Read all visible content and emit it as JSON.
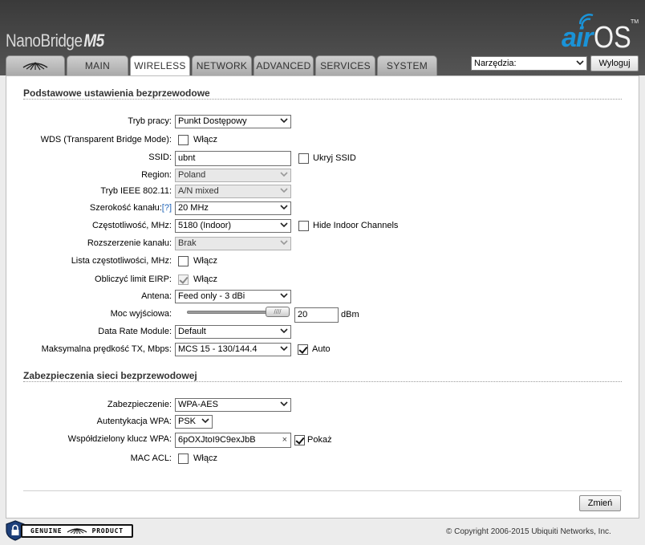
{
  "header": {
    "brand": "NanoBridge",
    "model": "M5",
    "logo_air": "air",
    "logo_os": "OS",
    "logo_tm": "TM"
  },
  "tabs": [
    {
      "label": "",
      "icon": "ubnt-logo-icon"
    },
    {
      "label": "MAIN"
    },
    {
      "label": "WIRELESS",
      "active": true
    },
    {
      "label": "NETWORK"
    },
    {
      "label": "ADVANCED"
    },
    {
      "label": "SERVICES"
    },
    {
      "label": "SYSTEM"
    }
  ],
  "tools": {
    "selected": "Narzędzia:",
    "logout": "Wyloguj"
  },
  "basic": {
    "title": "Podstawowe ustawienia bezprzewodowe",
    "mode": {
      "label": "Tryb pracy:",
      "value": "Punkt Dostępowy"
    },
    "wds": {
      "label": "WDS (Transparent Bridge Mode):",
      "checkbox": "Włącz",
      "checked": false
    },
    "ssid": {
      "label": "SSID:",
      "value": "ubnt",
      "hide_label": "Ukryj SSID",
      "hide_checked": false
    },
    "region": {
      "label": "Region:",
      "value": "Poland"
    },
    "ieee": {
      "label": "Tryb IEEE 802.11:",
      "value": "A/N mixed"
    },
    "width": {
      "label": "Szerokość kanału:",
      "help": "[?]",
      "value": "20 MHz"
    },
    "freq": {
      "label": "Częstotliwość, MHz:",
      "value": "5180 (Indoor)",
      "hide_label": "Hide Indoor Channels",
      "hide_checked": false
    },
    "ext": {
      "label": "Rozszerzenie kanału:",
      "value": "Brak"
    },
    "freqlist": {
      "label": "Lista częstotliwości, MHz:",
      "checkbox": "Włącz",
      "checked": false
    },
    "eirp": {
      "label": "Obliczyć limit EIRP:",
      "checkbox": "Włącz",
      "checked": true
    },
    "antenna": {
      "label": "Antena:",
      "value": "Feed only - 3 dBi"
    },
    "power": {
      "label": "Moc wyjściowa:",
      "value": "20",
      "unit": "dBm",
      "level": 0.78
    },
    "datarate": {
      "label": "Data Rate Module:",
      "value": "Default"
    },
    "maxtx": {
      "label": "Maksymalna prędkość TX, Mbps:",
      "value": "MCS 15 - 130/144.4",
      "auto_label": "Auto",
      "auto_checked": true
    }
  },
  "security": {
    "title": "Zabezpieczenia sieci bezprzewodowej",
    "security": {
      "label": "Zabezpieczenie:",
      "value": "WPA-AES"
    },
    "auth": {
      "label": "Autentykacja WPA:",
      "value": "PSK"
    },
    "psk": {
      "label": "Współdzielony klucz WPA:",
      "value": "6pOXJtoI9C9exJbB",
      "show_label": "Pokaż",
      "show_checked": true
    },
    "macacl": {
      "label": "MAC ACL:",
      "checkbox": "Włącz",
      "checked": false
    }
  },
  "footer": {
    "change": "Zmień",
    "genuine_text": "GENUINE",
    "product_text": "PRODUCT",
    "copyright": "© Copyright 2006-2015 Ubiquiti Networks, Inc."
  },
  "colors": {
    "accent": "#1a93d8",
    "header_bg": "#444444"
  }
}
